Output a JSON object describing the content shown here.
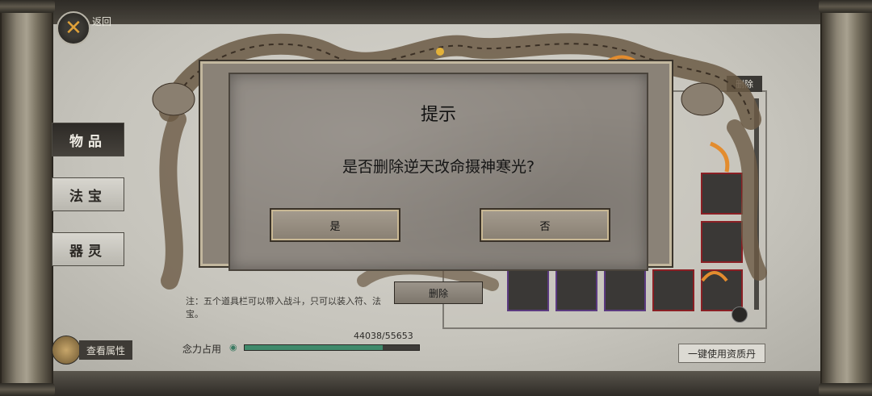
{
  "nav": {
    "back_label": "返回"
  },
  "sidebar": {
    "tabs": [
      {
        "label": "物品",
        "active": true
      },
      {
        "label": "法宝",
        "active": false
      },
      {
        "label": "器灵",
        "active": false
      }
    ]
  },
  "inventory": {
    "delete_tag": "删除",
    "note": "注：五个道具栏可以带入战斗，只可以装入符、法宝。",
    "view_attributes_label": "查看属性",
    "power_label": "念力占用",
    "power_value": "44038/55653",
    "power_fraction": 0.791,
    "use_all_label": "一键使用资质丹"
  },
  "dialog": {
    "title": "提示",
    "message": "是否删除逆天改命摄神寒光?",
    "yes_label": "是",
    "no_label": "否"
  },
  "delete_button_label": "删除",
  "colors": {
    "accent_orange": "#e0a23a",
    "slot_red": "#8a1f24",
    "power_green": "#3f8a6b"
  }
}
